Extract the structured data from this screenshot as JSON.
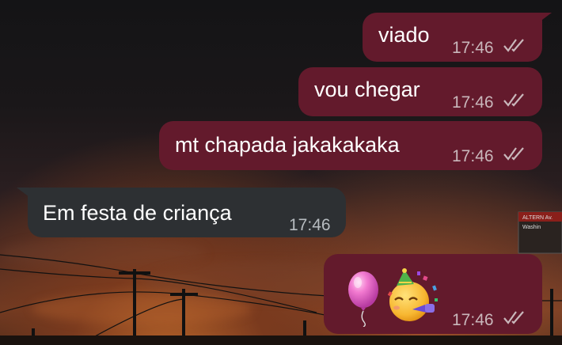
{
  "messages": [
    {
      "direction": "out",
      "text": "viado",
      "time": "17:46",
      "status": "read-double-check"
    },
    {
      "direction": "out",
      "text": "vou chegar",
      "time": "17:46",
      "status": "read-double-check"
    },
    {
      "direction": "out",
      "text": "mt chapada jakakakaka",
      "time": "17:46",
      "status": "read-double-check"
    },
    {
      "direction": "in",
      "text": "Em festa de criança",
      "time": "17:46"
    },
    {
      "direction": "out",
      "emojis": [
        "balloon",
        "partying-face"
      ],
      "time": "17:46",
      "status": "read-double-check"
    }
  ],
  "background_sign": "ALTERN Av. Washin",
  "colors": {
    "outgoing_bubble": "#631a2c",
    "incoming_bubble": "#2d3033",
    "background": "sunset-sky"
  }
}
